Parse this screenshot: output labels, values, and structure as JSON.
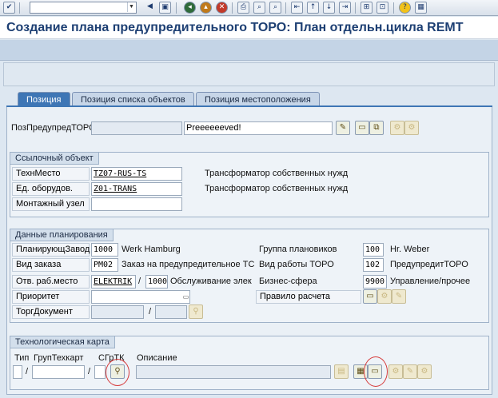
{
  "title": "Создание плана предупредительного ТОРО: План отдельн.цикла REMT",
  "toolbar": {
    "command_value": "",
    "icons": [
      "check-icon",
      "save-icon",
      "back-icon",
      "exit-icon",
      "cancel-icon",
      "print-icon",
      "find-icon",
      "find-next-icon",
      "first-page-icon",
      "prev-page-icon",
      "next-page-icon",
      "last-page-icon",
      "new-session-icon",
      "shortcut-icon",
      "help-icon",
      "layout-icon"
    ]
  },
  "tabs": [
    {
      "label": "Позиция",
      "active": true
    },
    {
      "label": "Позиция списка объектов",
      "active": false
    },
    {
      "label": "Позиция местоположения",
      "active": false
    }
  ],
  "item": {
    "label": "ПозПредупредТОРС",
    "number": "",
    "text": "Preeeeeeved!"
  },
  "reference_object": {
    "title": "Ссылочный объект",
    "func_loc_label": "ТехнМесто",
    "func_loc_value": "TZ07-RUS-TS",
    "func_loc_desc": "Трансформатор собственных нужд",
    "equipment_label": "Ед. оборудов.",
    "equipment_value": "Z01-TRANS",
    "equipment_desc": "Трансформатор собственных нужд",
    "assembly_label": "Монтажный узел",
    "assembly_value": ""
  },
  "planning": {
    "title": "Данные планирования",
    "plant_label": "ПланирующЗавод",
    "plant_value": "1000",
    "plant_desc": "Werk Hamburg",
    "order_type_label": "Вид заказа",
    "order_type_value": "PM02",
    "order_type_desc": "Заказ на предупредительное ТС",
    "work_center_label": "Отв. раб.место",
    "work_center_value": "ELEKTRIK",
    "work_center_plant": "1000",
    "work_center_desc": "Обслуживание элек",
    "priority_label": "Приоритет",
    "priority_value": "",
    "sales_doc_label": "ТоргДокумент",
    "sales_doc_value": "",
    "sales_doc_item": "",
    "planner_group_label": "Группа плановиков",
    "planner_group_value": "100",
    "planner_group_desc": "Hr. Weber",
    "activity_type_label": "Вид работы ТОРО",
    "activity_type_value": "102",
    "activity_type_desc": "ПредупредитТОРО",
    "business_area_label": "Бизнес-сфера",
    "business_area_value": "9900",
    "business_area_desc": "Управление/прочее",
    "settlement_rule_label": "Правило расчета"
  },
  "task_list": {
    "title": "Технологическая карта",
    "type_label": "Тип",
    "group_label": "ГрупТехкарт",
    "counter_label": "СГрТК",
    "description_label": "Описание",
    "type_value": "",
    "group_value": "",
    "counter_value": "",
    "description_value": ""
  },
  "separator": "/",
  "colors": {
    "title": "#1d3f73",
    "active_tab": "#3e76b5",
    "annotation_circle": "#d63a3a"
  }
}
